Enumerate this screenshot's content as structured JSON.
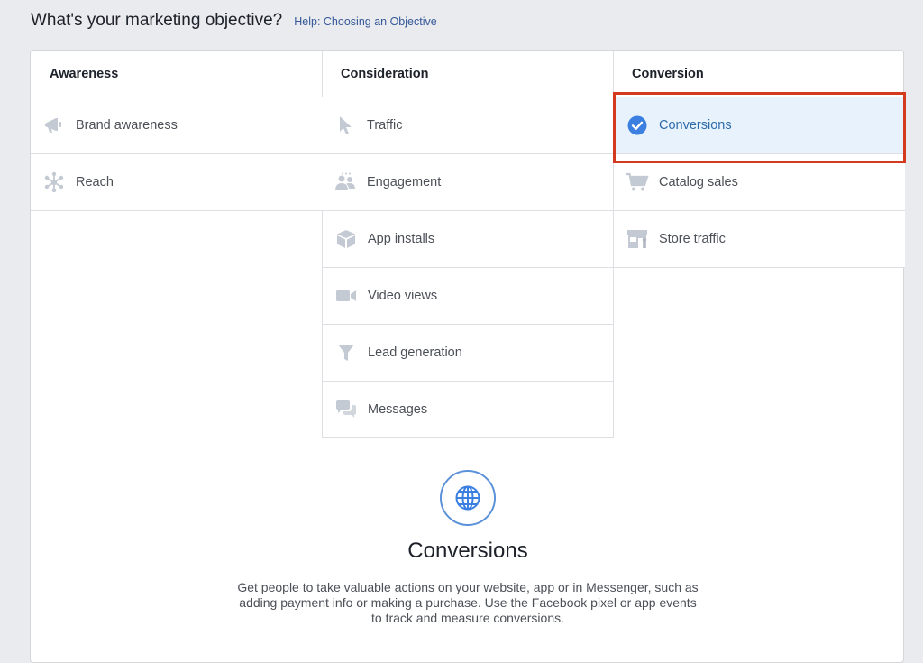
{
  "header": {
    "title": "What's your marketing objective?",
    "help_link": "Help: Choosing an Objective"
  },
  "columns": [
    {
      "label": "Awareness",
      "items": [
        {
          "label": "Brand awareness",
          "icon": "megaphone-icon"
        },
        {
          "label": "Reach",
          "icon": "reach-icon"
        }
      ]
    },
    {
      "label": "Consideration",
      "items": [
        {
          "label": "Traffic",
          "icon": "cursor-icon"
        },
        {
          "label": "Engagement",
          "icon": "people-icon"
        },
        {
          "label": "App installs",
          "icon": "box-icon"
        },
        {
          "label": "Video views",
          "icon": "video-camera-icon"
        },
        {
          "label": "Lead generation",
          "icon": "funnel-icon"
        },
        {
          "label": "Messages",
          "icon": "chat-bubbles-icon"
        }
      ]
    },
    {
      "label": "Conversion",
      "items": [
        {
          "label": "Conversions",
          "icon": "check-circle-icon",
          "selected": true
        },
        {
          "label": "Catalog sales",
          "icon": "cart-icon"
        },
        {
          "label": "Store traffic",
          "icon": "store-icon"
        }
      ]
    }
  ],
  "detail": {
    "icon": "globe-icon",
    "title": "Conversions",
    "description": "Get people to take valuable actions on your website, app or in Messenger, such as adding payment info or making a purchase. Use the Facebook pixel or app events to track and measure conversions."
  },
  "colors": {
    "selected_bg": "#e8f2fc",
    "selected_text": "#2d6ba8",
    "highlight_outline": "#d33a1e",
    "icon_gray": "#c4cad3",
    "link": "#365899"
  }
}
